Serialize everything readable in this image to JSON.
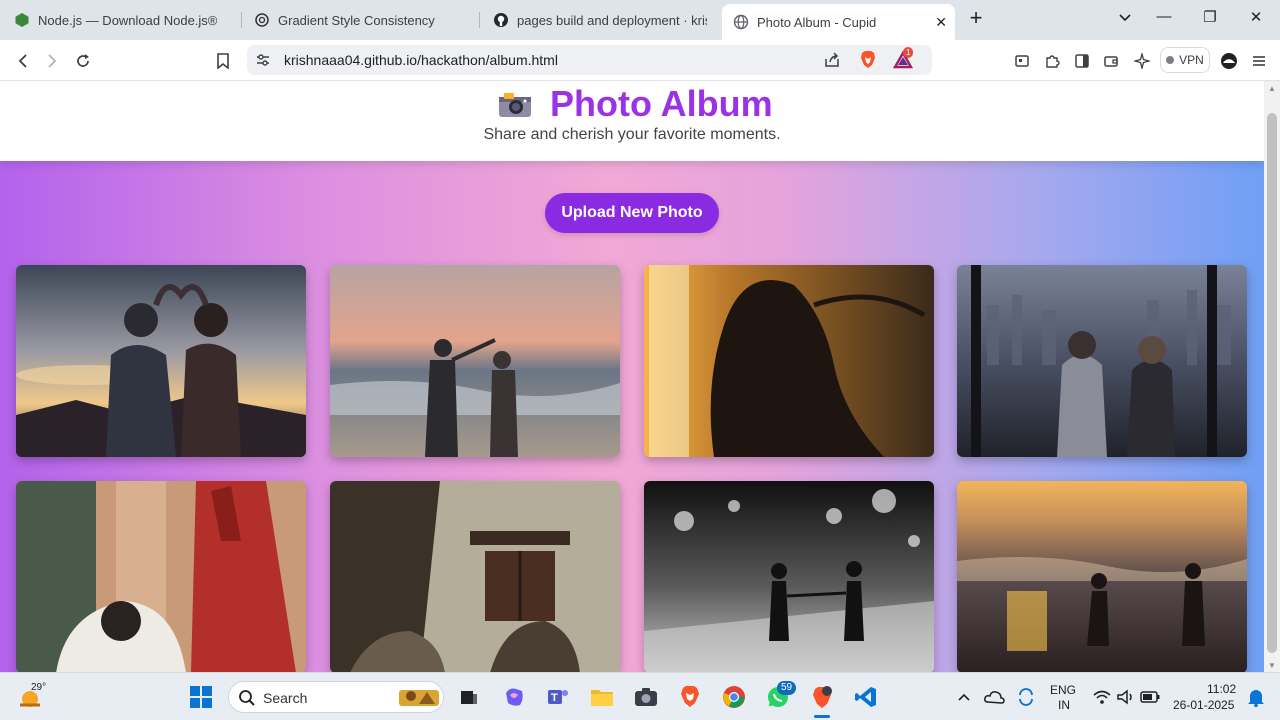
{
  "browser": {
    "tabs": [
      {
        "title": "Node.js — Download Node.js®",
        "icon": "nodejs-icon",
        "active": false
      },
      {
        "title": "Gradient Style Consistency",
        "icon": "chatgpt-icon",
        "active": false
      },
      {
        "title": "pages build and deployment · krishn",
        "icon": "github-icon",
        "active": false
      },
      {
        "title": "Photo Album - Cupid",
        "icon": "globe-icon",
        "active": true
      }
    ],
    "url": "krishnaaa04.github.io/hackathon/album.html",
    "vpn_label": "VPN",
    "notification_count": "1"
  },
  "page": {
    "title": "Photo Album",
    "title_icon": "camera-icon",
    "subtitle": "Share and cherish your favorite moments.",
    "upload_button": "Upload New Photo",
    "photos": [
      {
        "name": "couple-heart-sunset"
      },
      {
        "name": "couple-dancing-beach"
      },
      {
        "name": "silhouette-sunset-water"
      },
      {
        "name": "couple-city-view"
      },
      {
        "name": "saree-wall"
      },
      {
        "name": "old-house-vintage"
      },
      {
        "name": "couple-walking-bw"
      },
      {
        "name": "couple-beach-sunset"
      }
    ]
  },
  "taskbar": {
    "weather_temp": "29°",
    "search_placeholder": "Search",
    "whatsapp_badge": "59",
    "lang_line1": "ENG",
    "lang_line2": "IN",
    "time": "11:02",
    "date": "26-01-2025"
  },
  "colors": {
    "accent": "#8a2be2",
    "title": "#9a32e8"
  }
}
